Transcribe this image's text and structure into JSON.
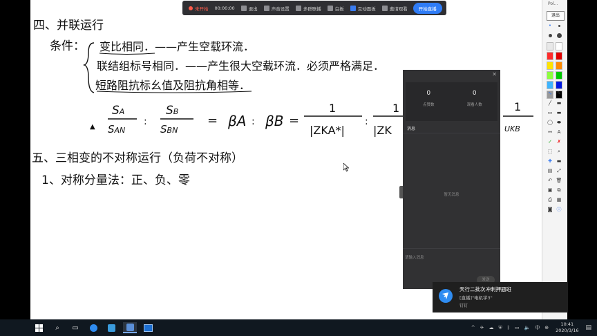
{
  "toolbar": {
    "record_label": "未开始",
    "timer": "00:00:00",
    "items": [
      "退出",
      "声音设置",
      "多群联播",
      "白板",
      "互动面板",
      "邀请观看"
    ],
    "start_label": "开始直播"
  },
  "palette": {
    "title": "Pol...",
    "exit_label": "退出",
    "colors": [
      "#e8e8e8",
      "#ffffff",
      "#ff2b2b",
      "#e00000",
      "#ffe400",
      "#ff8a00",
      "#8cff3c",
      "#00c800",
      "#3cb4ff",
      "#0018e0",
      "#9a9a9a",
      "#000000"
    ]
  },
  "whiteboard": {
    "lines": [
      "四、并联运行",
      "条件：",
      "变比相同．——产生空载环流．",
      "联结组标号相同．——产生很大空载环流．必须严格满足．",
      "短路阻抗标幺值及阻抗角相等．",
      "五、三相变的不对称运行（负荷不对称）",
      "1、对称分量法：正、负、零"
    ],
    "formula": {
      "f1_num": "S",
      "f1_sub": "A",
      "f1_den": "S",
      "f1_den_sub": "AN",
      "f2_num": "S",
      "f2_sub": "B",
      "f2_den": "S",
      "f2_den_sub": "BN",
      "beta_a": "βA",
      "beta_b": "βB",
      "f3_num": "1",
      "f3_den": "|ZKA*|",
      "f4_num": "1",
      "f4_den": "|ZK",
      "f5_num": "1",
      "f5_den": "UKB"
    }
  },
  "panel": {
    "stats": [
      {
        "value": "0",
        "label": "点赞数"
      },
      {
        "value": "0",
        "label": "观看人数"
      }
    ],
    "messages_label": "消息",
    "empty_text": "暂无消息",
    "input_placeholder": "请输入消息",
    "send_label": "发送"
  },
  "toast": {
    "title": "天行二批次冲刺押题班",
    "body": "[直播]\"电机学3\"",
    "app": "钉钉"
  },
  "taskbar": {
    "time": "10:41",
    "date": "2020/3/16",
    "ime": "中"
  }
}
